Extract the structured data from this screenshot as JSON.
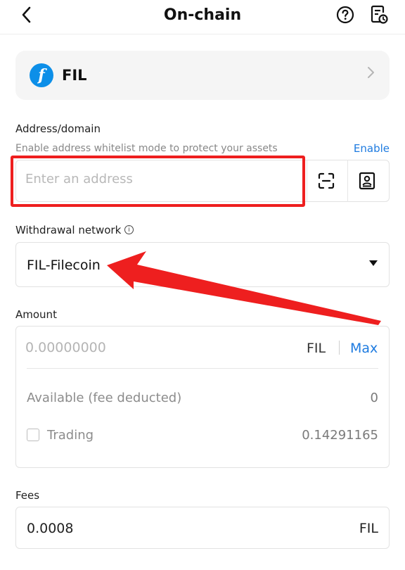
{
  "header": {
    "back_icon": "chevron-left-icon",
    "title": "On-chain",
    "help_icon": "question-circle-icon",
    "history_icon": "document-clock-icon"
  },
  "coin": {
    "symbol": "FIL",
    "logo_glyph": "f",
    "logo_color": "#0d8fe8",
    "chevron_icon": "chevron-right-icon"
  },
  "address": {
    "label": "Address/domain",
    "hint": "Enable address whitelist mode to protect your assets",
    "enable_link": "Enable",
    "placeholder": "Enter an address",
    "scan_icon": "scan-icon",
    "book_icon": "address-book-icon"
  },
  "network": {
    "label": "Withdrawal network",
    "info_glyph": "i",
    "value": "FIL-Filecoin",
    "caret_icon": "caret-down-icon"
  },
  "amount": {
    "label": "Amount",
    "placeholder": "0.00000000",
    "unit": "FIL",
    "max_label": "Max",
    "available_label": "Available (fee deducted)",
    "available_value": "0",
    "trading_label": "Trading",
    "trading_value": "0.14291165",
    "trading_checked": false
  },
  "fees": {
    "label": "Fees",
    "value": "0.0008",
    "unit": "FIL"
  },
  "annotations": {
    "highlight_color": "#ee1f1f"
  }
}
